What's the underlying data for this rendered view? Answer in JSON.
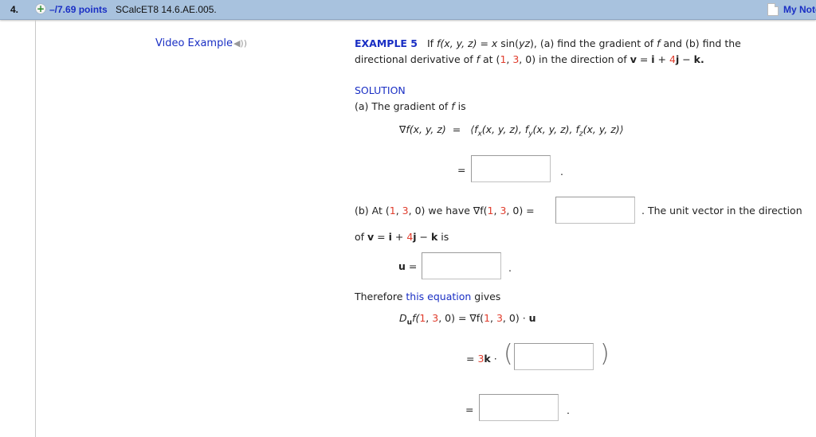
{
  "header": {
    "question_number": "4.",
    "plus_icon": "plus-circle-icon",
    "points": "–/7.69 points",
    "problem_code": "SCalcET8 14.6.AE.005.",
    "notes_icon": "note-icon",
    "notes_label": "My Notes"
  },
  "video": {
    "label": "Video Example",
    "icon": "speaker-icon"
  },
  "example": {
    "label": "EXAMPLE 5",
    "line1_if": "If",
    "fxyz": "f(x, y, z)",
    "eq": " = ",
    "x": "x",
    "sin": " sin(",
    "yz": "yz",
    "close": "),",
    "line1_rest": "  (a) find the gradient of ",
    "f": "f",
    "line1_rest2": " and (b) find the",
    "line2_a": "directional derivative of ",
    "line2_at": " at  (",
    "p1": "1",
    "comma": ", ",
    "p2": "3",
    "p3": ", 0)",
    "line2_dir": "  in the direction of  ",
    "v": "v",
    "eqs": " = ",
    "i": "i",
    "plus": " + ",
    "four": "4",
    "j": "j",
    "minus": " − ",
    "k": "k",
    "dot": "."
  },
  "solution": {
    "label": "SOLUTION",
    "part_a": "(a) The gradient of ",
    "part_a_f": "f",
    "part_a_is": " is",
    "grad_lhs": "∇f(x, y, z)",
    "grad_eq": "=",
    "grad_rhs": "⟨fx(x, y, z), fy(x, y, z), fz(x, y, z)⟩",
    "eq_sign": "=",
    "period": ".",
    "part_b_prefix": "(b) At (",
    "part_b_mid": ") we have  ∇f(",
    "part_b_end": ") =",
    "one": "1",
    "three": "3",
    "zero_sep": ", ",
    "zero": "0",
    "unit_vector_text": ".  The unit vector in the direction",
    "of_v": "of  ",
    "is": "  is",
    "u_label": "u",
    "u_eq": " =",
    "therefore": "Therefore ",
    "this_equation": "this equation",
    "gives": " gives",
    "du_lhs_D": "D",
    "du_lhs_u": "u",
    "du_lhs_f": "f(",
    "du_eq": "  =  ∇f(",
    "du_dot": " · ",
    "three_k_3": "3",
    "three_k_k": "k",
    "dot_op": " ·"
  },
  "inputs": {
    "gradient_answer": "",
    "grad_at_point_answer": "",
    "unit_vector_answer": "",
    "inner_product_answer": "",
    "final_answer": ""
  }
}
